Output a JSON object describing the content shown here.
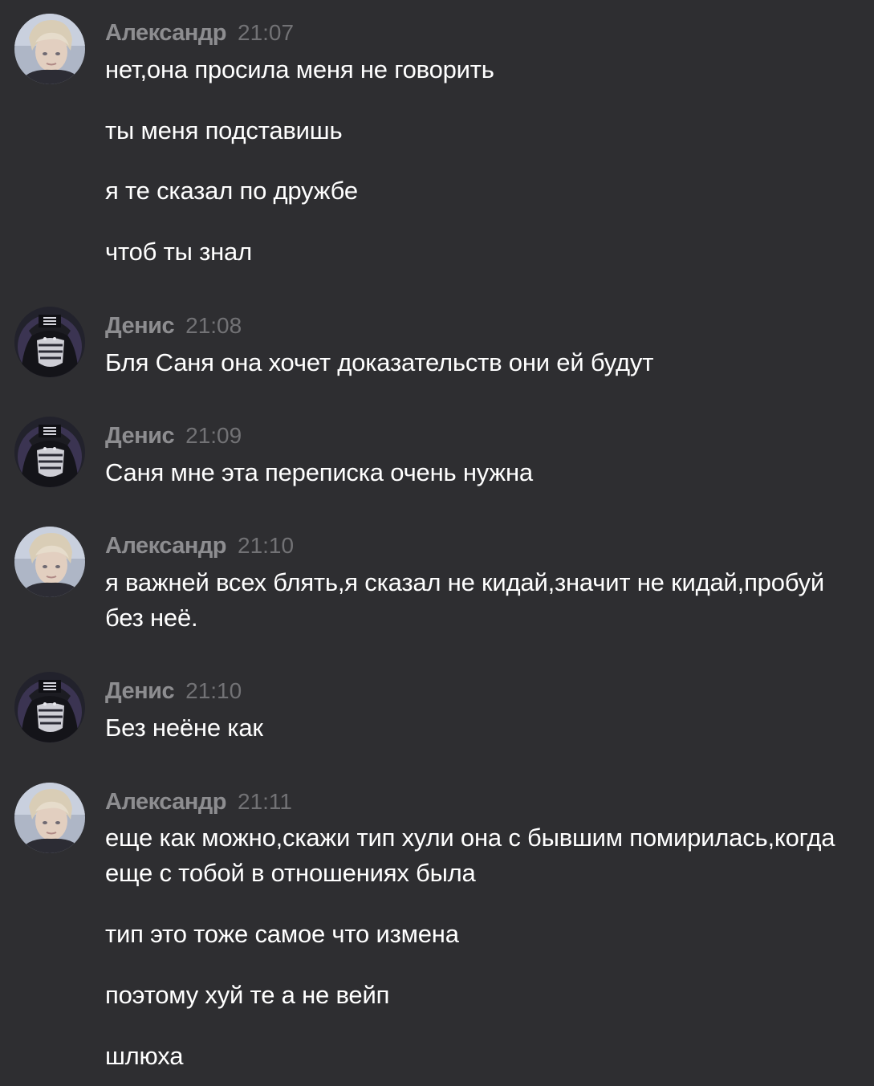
{
  "messages": [
    {
      "author": "Александр",
      "time": "21:07",
      "avatar": "alexander-avatar",
      "lines": [
        "нет,она просила меня не говорить",
        "ты меня подставишь",
        "я те сказал по дружбе",
        "чтоб ты знал"
      ]
    },
    {
      "author": "Денис",
      "time": "21:08",
      "avatar": "denis-avatar",
      "lines": [
        "Бля Саня она хочет доказательств они ей будут"
      ]
    },
    {
      "author": "Денис",
      "time": "21:09",
      "avatar": "denis-avatar",
      "lines": [
        "Саня мне эта переписка очень нужна"
      ]
    },
    {
      "author": "Александр",
      "time": "21:10",
      "avatar": "alexander-avatar",
      "lines": [
        "я важней всех блять,я сказал не кидай,значит не кидай,пробуй без неё."
      ]
    },
    {
      "author": "Денис",
      "time": "21:10",
      "avatar": "denis-avatar",
      "lines": [
        "Без неёне как"
      ]
    },
    {
      "author": "Александр",
      "time": "21:11",
      "avatar": "alexander-avatar",
      "lines": [
        "еще как можно,скажи тип хули она с бывшим помирилась,когда еще с тобой в отношениях была",
        "тип это тоже самое что измена",
        "поэтому хуй те а не вейп",
        "шлюха"
      ]
    }
  ],
  "colors": {
    "background": "#2e2e31",
    "author": "#8d8d90",
    "time": "#727275",
    "text": "#ffffff"
  }
}
